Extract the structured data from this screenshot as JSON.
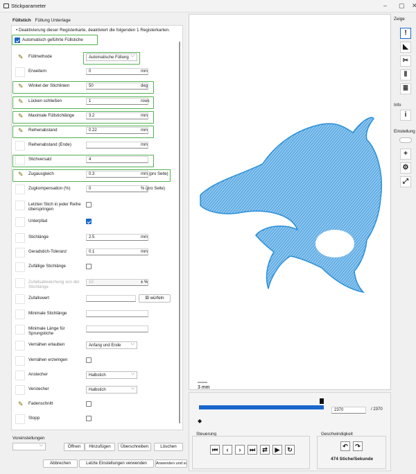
{
  "window": {
    "title": "Stickparameter",
    "min": "–",
    "max": "▢",
    "close": "✕"
  },
  "tabs": [
    "Füllstich",
    "Füllung Unterlage"
  ],
  "notice": "• Deaktivierung dieser Registerkarte, deaktiviert die folgenden 1 Registerkarten.",
  "auto_label": "Automatisch geführte Füllstiche",
  "fields": {
    "fillmethod": {
      "label": "Füllmethode",
      "value": "Automatische Füllung"
    },
    "expand": {
      "label": "Erweitern",
      "value": "0",
      "unit": "mm"
    },
    "angle": {
      "label": "Winkel der Stichlinien",
      "value": "50",
      "unit": "deg"
    },
    "gaps": {
      "label": "Lücken schließen",
      "value": "1",
      "unit": "rows"
    },
    "maxlen": {
      "label": "Maximale Füllstichlänge",
      "value": "3.2",
      "unit": "mm"
    },
    "rowspacing": {
      "label": "Reihenabstand",
      "value": "0.22",
      "unit": "mm"
    },
    "rowspacing_end": {
      "label": "Reihenabstand (Ende)",
      "value": "",
      "unit": "mm"
    },
    "stagger": {
      "label": "Stichversatz",
      "value": "4"
    },
    "pull": {
      "label": "Zugausgleich",
      "value": "0.3",
      "unit": "mm (pro Seite)"
    },
    "pull_pct": {
      "label": "Zugkompensation (%)",
      "value": "0",
      "unit": "% (pro Seite)"
    },
    "last_stitch": {
      "label": "Letzten Stich in jeder Reihe überspringen"
    },
    "underpath": {
      "label": "Unterpfad"
    },
    "stitchlen": {
      "label": "Stichlänge",
      "value": "2.5",
      "unit": "mm"
    },
    "tolerance": {
      "label": "Geradstich-Toleranz",
      "value": "0.1",
      "unit": "mm"
    },
    "random_len": {
      "label": "Zufällige Stichlänge"
    },
    "random_dev": {
      "label": "Zufallsabweichung von der Stichlänge",
      "value": "10",
      "unit": "± %"
    },
    "random_val": {
      "label": "Zufallswert",
      "value": "",
      "button": "würfeln"
    },
    "min_len": {
      "label": "Minimale Stichlänge",
      "value": ""
    },
    "min_jump": {
      "label": "Minimale Länge für Sprungstiche",
      "value": ""
    },
    "tie_allow": {
      "label": "Vernähen erlauben",
      "value": "Anfang und Ende"
    },
    "tie_force": {
      "label": "Vernähen erzwingen"
    },
    "tie_in": {
      "label": "Anstecher",
      "value": "Halbstich"
    },
    "tie_out": {
      "label": "Verstecher",
      "value": "Halbstich"
    },
    "trim": {
      "label": "Fadenschnitt"
    },
    "stop": {
      "label": "Stopp"
    }
  },
  "presets": {
    "label": "Voreinstellungen",
    "open": "Öffnen",
    "add": "Hinzufügen",
    "overwrite": "Überschreiben",
    "delete": "Löschen"
  },
  "actions": {
    "cancel": "Abbrechen",
    "last": "Letzte Einstellungen verwenden",
    "apply": "Anwenden und schließen"
  },
  "preview": {
    "scale": "3 mm"
  },
  "sim": {
    "current": "2370",
    "total": "/ 2370",
    "progress": 1.0,
    "steuerung": "Steuerung",
    "speed_label": "Geschwindigkeit",
    "speed": "474 Stiche/Sekunde"
  },
  "sidebar": {
    "show": "Zeige",
    "info": "Info",
    "settings": "Einstellung"
  },
  "colors": {
    "accent": "#1a66cc",
    "green": "#52b152",
    "stitch": "#2a8fd6"
  }
}
